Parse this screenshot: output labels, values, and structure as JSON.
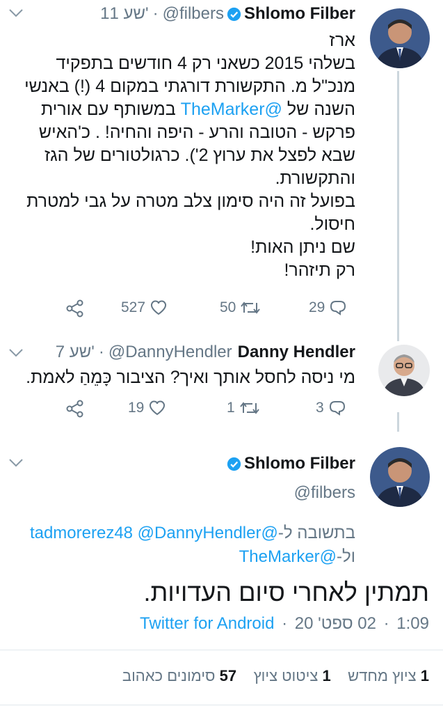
{
  "tweet1": {
    "name": "Shlomo Filber",
    "handle": "@filbers",
    "time": "11 שע'",
    "sep": "·",
    "lines": [
      "ארז",
      "בשלהי 2015 כשאני רק 4 חודשים בתפקיד",
      "מנכ\"ל מ. התקשורת דורגתי במקום 4 (!) באנשי",
      "השנה של ",
      "פרקש - הטובה והרע - היפה והחיה! . כ'האיש",
      "שבא לפצל את ערוץ 2'). כרגולטורים של הגז",
      "והתקשורת.",
      "בפועל זה היה סימון צלב מטרה על גבי למטרת",
      "חיסול.",
      "שם ניתן האות!",
      "רק תיזהר!"
    ],
    "mention": "@TheMarker",
    "line4_tail": " במשותף עם אורית",
    "replies": "29",
    "retweets": "50",
    "likes": "527"
  },
  "tweet2": {
    "name": "Danny Hendler",
    "handle": "@DannyHendler",
    "time": "7 שע'",
    "sep": "·",
    "text": "מי ניסה לחסל אותך ואיך? הציבור כָּמֵהַ לאמת.",
    "replies": "3",
    "retweets": "1",
    "likes": "19"
  },
  "tweet3": {
    "name": "Shlomo Filber",
    "handle": "@filbers",
    "reply_prefix": "בתשובה ל-",
    "reply_mentions": "@tadmorerez48 @DannyHendler",
    "reply_and": "ול-",
    "reply_mention2": "@TheMarker",
    "text": "תמתין לאחרי סיום העדויות.",
    "time": "1:09",
    "date": "02 ספט' 20",
    "source": "Twitter for Android",
    "sep": "·"
  },
  "stats": {
    "retweets_count": "1",
    "retweets_label": "ציוץ מחדש",
    "quotes_count": "1",
    "quotes_label": "ציטוט ציוץ",
    "likes_count": "57",
    "likes_label": "סימונים כאהוב"
  },
  "colors": {
    "accent": "#1da1f2",
    "text": "#14171a",
    "muted": "#657786",
    "divider": "#e1e8ed"
  }
}
